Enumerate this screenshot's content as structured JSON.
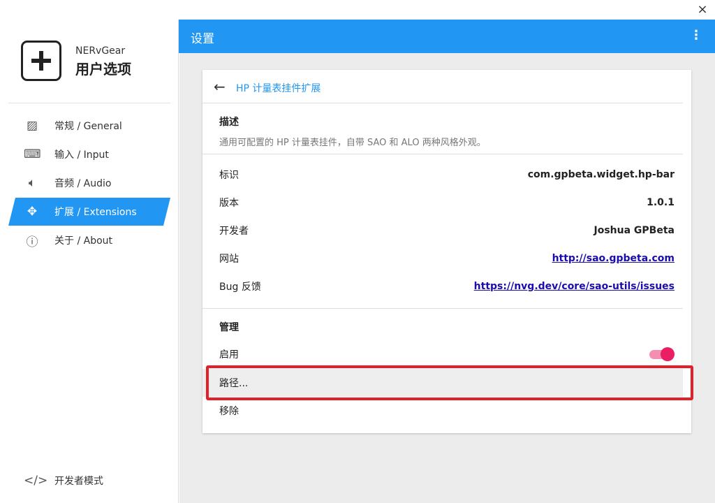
{
  "window": {
    "close": "×"
  },
  "sidebar": {
    "brand": "NERvGear",
    "title": "用户选项",
    "items": [
      {
        "label": "常规 / General",
        "icon": "image-icon"
      },
      {
        "label": "输入 / Input",
        "icon": "keyboard-icon"
      },
      {
        "label": "音频 / Audio",
        "icon": "speaker-icon"
      },
      {
        "label": "扩展 / Extensions",
        "icon": "puzzle-icon",
        "active": true
      },
      {
        "label": "关于 / About",
        "icon": "info-icon"
      }
    ],
    "dev_mode": "开发者模式"
  },
  "header": {
    "title": "设置",
    "menu": "⋮"
  },
  "card": {
    "title": "HP 计量表挂件扩展",
    "desc_heading": "描述",
    "description": "通用可配置的 HP 计量表挂件，自带 SAO 和 ALO 两种风格外观。",
    "info": [
      {
        "label": "标识",
        "value": "com.gpbeta.widget.hp-bar"
      },
      {
        "label": "版本",
        "value": "1.0.1"
      },
      {
        "label": "开发者",
        "value": "Joshua GPBeta"
      },
      {
        "label": "网站",
        "value": "http://sao.gpbeta.com"
      },
      {
        "label": "Bug 反馈",
        "value": "https://nvg.dev/core/sao-utils/issues"
      }
    ],
    "manage_heading": "管理",
    "enable_label": "启用",
    "enabled": true,
    "path_label": "路径...",
    "remove_label": "移除"
  },
  "colors": {
    "accent": "#2196f3",
    "toggle": "#e91e63",
    "highlight": "#e3202a"
  }
}
